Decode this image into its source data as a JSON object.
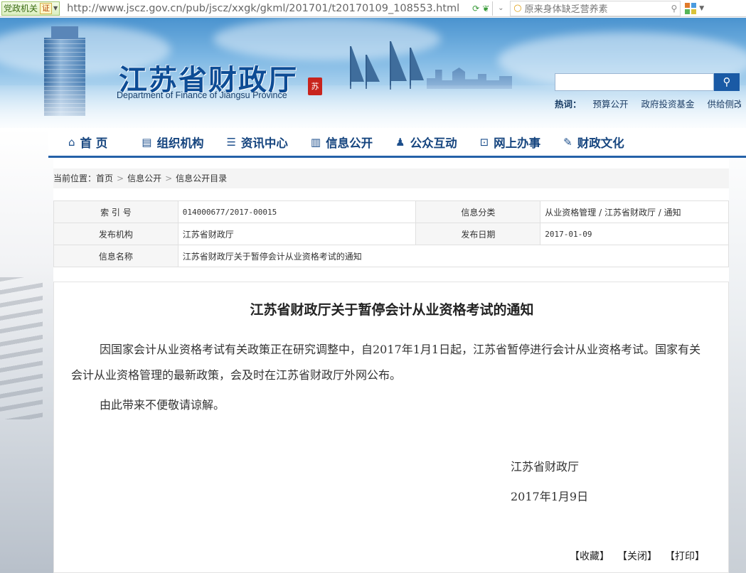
{
  "browser": {
    "cert_label": "党政机关",
    "cert_badge": "证",
    "url": "http://www.jscz.gov.cn/pub/jscz/xxgk/gkml/201701/t20170109_108553.html",
    "search_placeholder": "原来身体缺乏营养素"
  },
  "header": {
    "title": "江苏省财政厅",
    "subtitle": "Department of Finance of Jiangsu Province",
    "seal_text": "苏",
    "hot_label": "热词：",
    "hot_words": [
      "预算公开",
      "政府投资基金",
      "供给侧改"
    ]
  },
  "nav": {
    "items": [
      {
        "label": "首  页",
        "icon": "home-icon",
        "glyph": "⌂"
      },
      {
        "label": "组织机构",
        "icon": "org-icon",
        "glyph": "▤"
      },
      {
        "label": "资讯中心",
        "icon": "news-icon",
        "glyph": "☰"
      },
      {
        "label": "信息公开",
        "icon": "info-icon",
        "glyph": "▥"
      },
      {
        "label": "公众互动",
        "icon": "user-icon",
        "glyph": "♟"
      },
      {
        "label": "网上办事",
        "icon": "chart-icon",
        "glyph": "⊡"
      },
      {
        "label": "财政文化",
        "icon": "culture-icon",
        "glyph": "✎"
      }
    ]
  },
  "breadcrumb": {
    "prefix": "当前位置：",
    "items": [
      "首页",
      "信息公开",
      "信息公开目录"
    ]
  },
  "info": {
    "index_key": "索 引 号",
    "index_val": "014000677/2017-00015",
    "category_key": "信息分类",
    "category_val": "从业资格管理  / 江苏省财政厅  / 通知",
    "org_key": "发布机构",
    "org_val": "江苏省财政厅",
    "date_key": "发布日期",
    "date_val": "2017-01-09",
    "name_key": "信息名称",
    "name_val": "江苏省财政厅关于暂停会计从业资格考试的通知"
  },
  "article": {
    "title": "江苏省财政厅关于暂停会计从业资格考试的通知",
    "para1": "因国家会计从业资格考试有关政策正在研究调整中，自2017年1月1日起，江苏省暂停进行会计从业资格考试。国家有关会计从业资格管理的最新政策，会及时在江苏省财政厅外网公布。",
    "para2": "由此带来不便敬请谅解。",
    "sign_org": "江苏省财政厅",
    "sign_date": "2017年1月9日",
    "actions": [
      "【收藏】",
      "【关闭】",
      "【打印】"
    ]
  }
}
